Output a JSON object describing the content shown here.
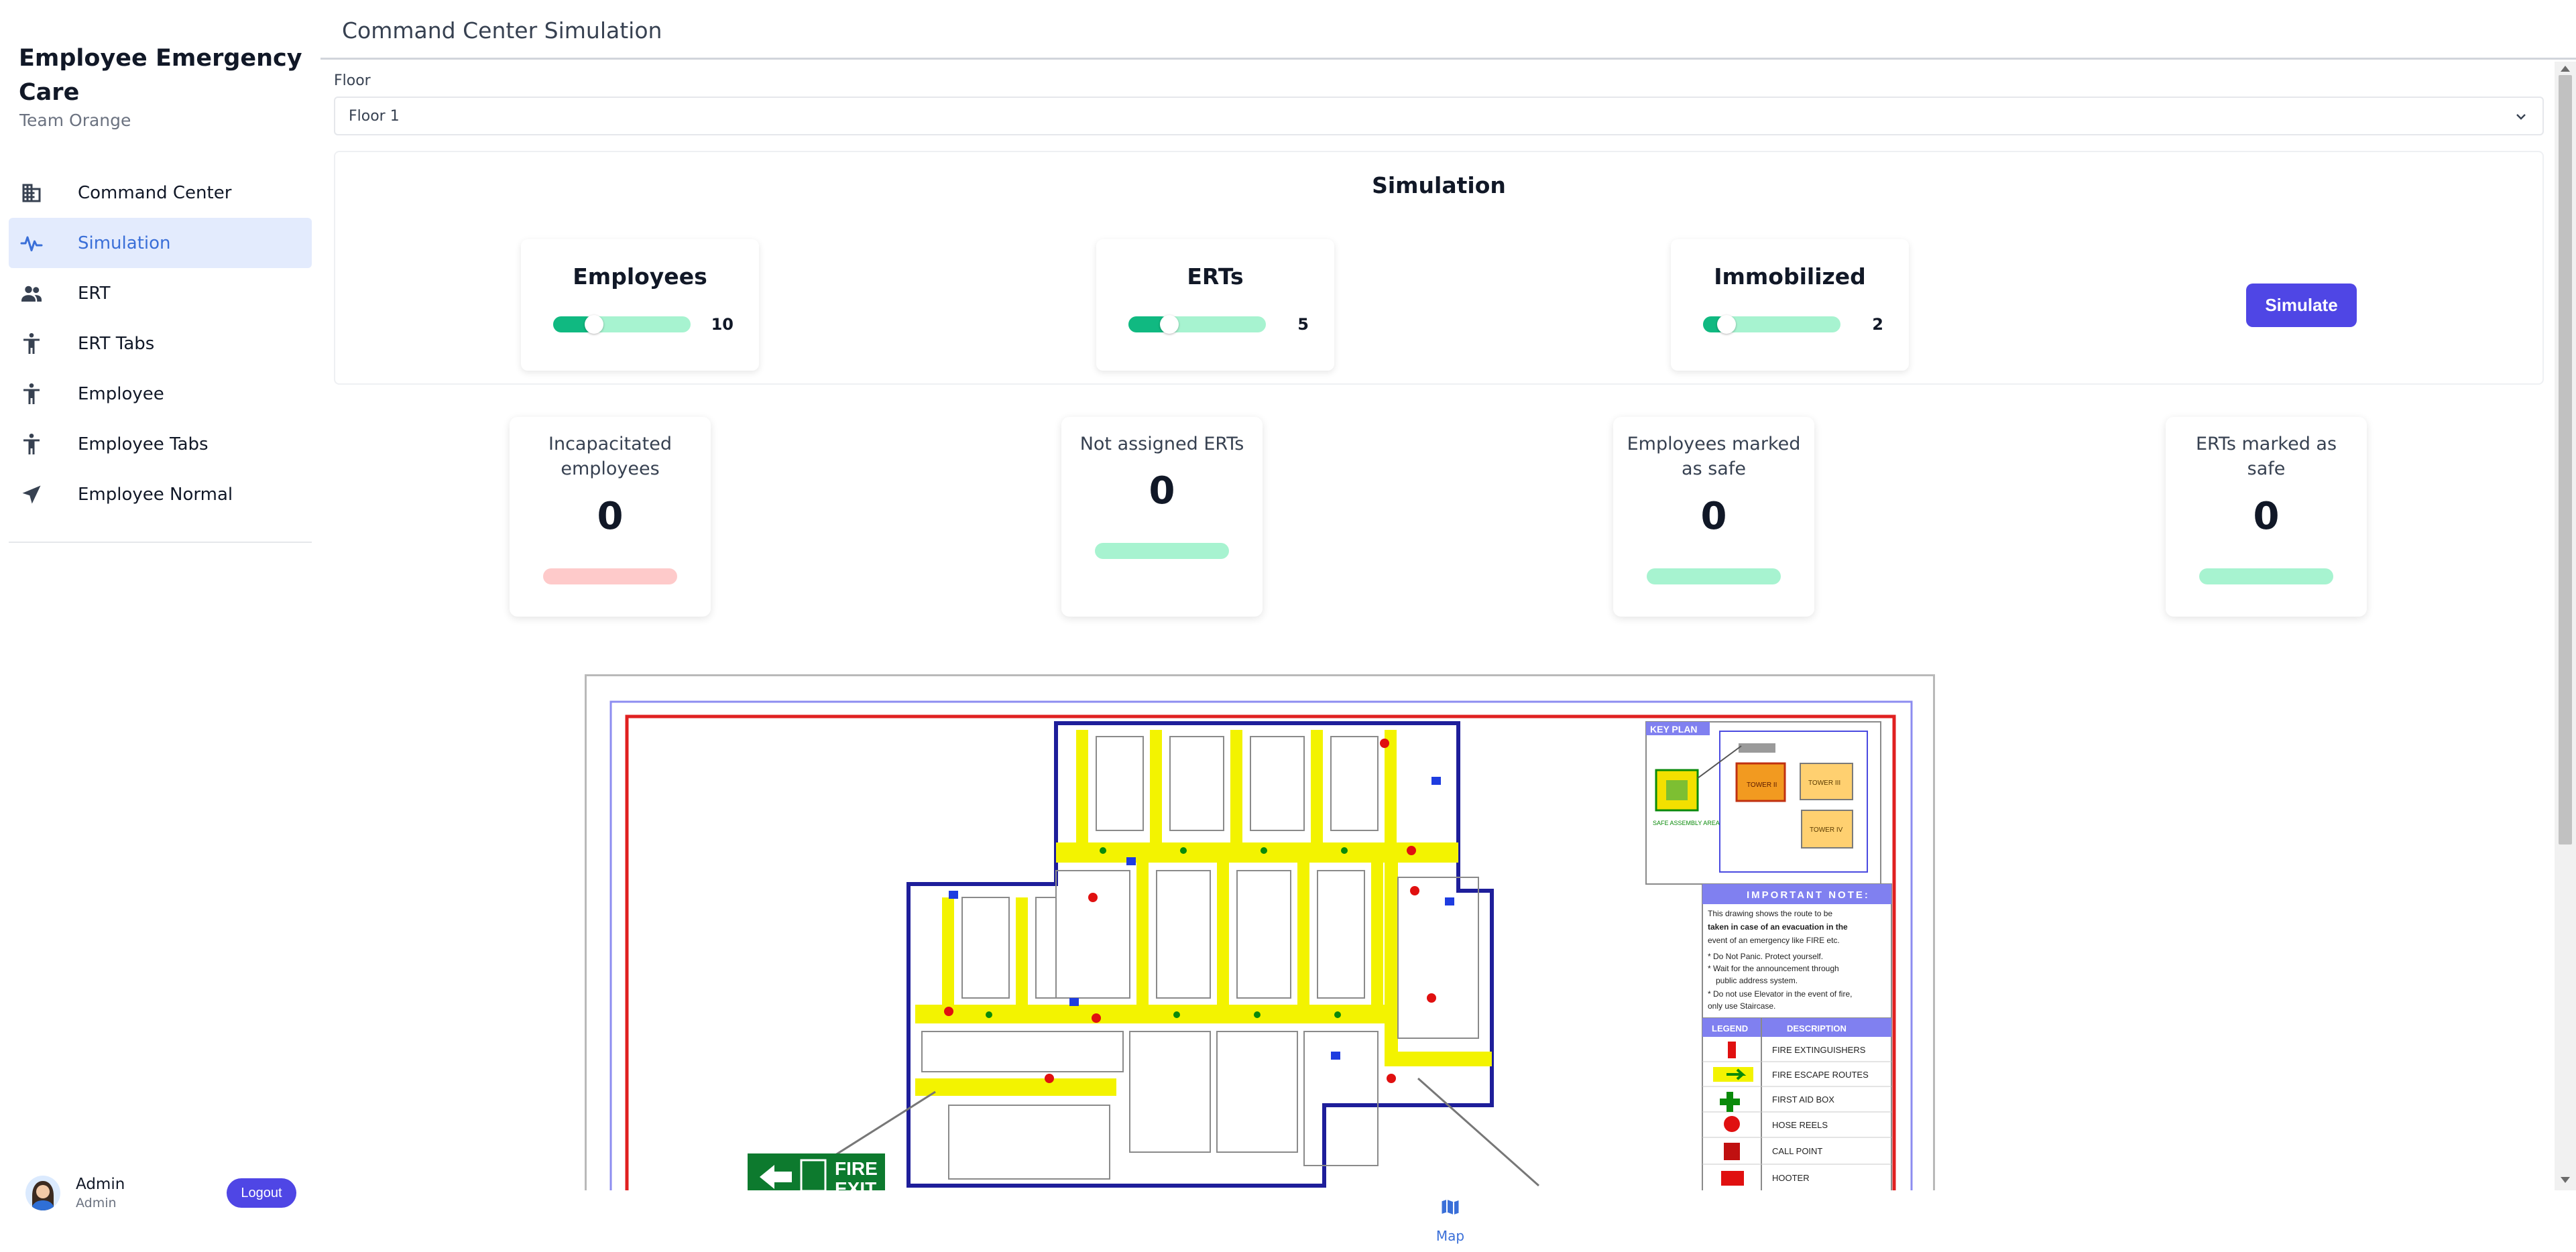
{
  "app": {
    "title": "Employee Emergency Care",
    "subtitle": "Team Orange"
  },
  "sidebar": {
    "items": [
      {
        "label": "Command Center",
        "icon": "building-icon",
        "active": false
      },
      {
        "label": "Simulation",
        "icon": "pulse-icon",
        "active": true
      },
      {
        "label": "ERT",
        "icon": "people-icon",
        "active": false
      },
      {
        "label": "ERT Tabs",
        "icon": "person-icon",
        "active": false
      },
      {
        "label": "Employee",
        "icon": "person-icon",
        "active": false
      },
      {
        "label": "Employee Tabs",
        "icon": "person-icon",
        "active": false
      },
      {
        "label": "Employee Normal",
        "icon": "navigation-arrow-icon",
        "active": false
      }
    ],
    "user": {
      "name": "Admin",
      "role": "Admin",
      "logout_label": "Logout"
    }
  },
  "header": {
    "title": "Command Center Simulation"
  },
  "floor": {
    "label": "Floor",
    "selected": "Floor 1"
  },
  "simulation": {
    "title": "Simulation",
    "sliders": [
      {
        "label": "Employees",
        "value": 10,
        "fraction": 0.25
      },
      {
        "label": "ERTs",
        "value": 5,
        "fraction": 0.25
      },
      {
        "label": "Immobilized",
        "value": 2,
        "fraction": 0.12
      }
    ],
    "simulate_label": "Simulate"
  },
  "stats": [
    {
      "label": "Incapacitated employees",
      "value": "0",
      "bar_color": "#fecaca"
    },
    {
      "label": "Not assigned ERTs",
      "value": "0",
      "bar_color": "#a7f3d0"
    },
    {
      "label": "Employees marked as safe",
      "value": "0",
      "bar_color": "#a7f3d0"
    },
    {
      "label": "ERTs marked as safe",
      "value": "0",
      "bar_color": "#a7f3d0"
    }
  ],
  "map": {
    "key_plan_label": "KEY PLAN",
    "key_plan_blocks": [
      "TOWER II",
      "TOWER III",
      "TOWER IV"
    ],
    "safe_assembly_label": "SAFE ASSEMBLY AREA",
    "note_title": "IMPORTANT NOTE:",
    "note_lines": [
      "This drawing shows the route to be",
      "taken in case of an evacuation in the",
      "event of an emergency like FIRE etc.",
      "* Do Not Panic. Protect yourself.",
      "* Wait for the announcement through",
      "public address system.",
      "* Do not use Elevator in the event of fire,",
      "only use Staircase."
    ],
    "legend_header": [
      "LEGEND",
      "DESCRIPTION"
    ],
    "legend": [
      "FIRE EXTINGUISHERS",
      "FIRE ESCAPE ROUTES",
      "FIRST AID BOX",
      "HOSE REELS",
      "CALL POINT",
      "HOOTER"
    ],
    "exit_sign": [
      "FIRE",
      "EXIT"
    ]
  },
  "bottom_nav": {
    "map_label": "Map"
  },
  "colors": {
    "accent": "#4f46e5",
    "active_nav_bg": "#e3ebfd",
    "active_nav_text": "#3a6fd8",
    "slider_fill": "#10b981",
    "slider_track": "#a7f3d0"
  }
}
